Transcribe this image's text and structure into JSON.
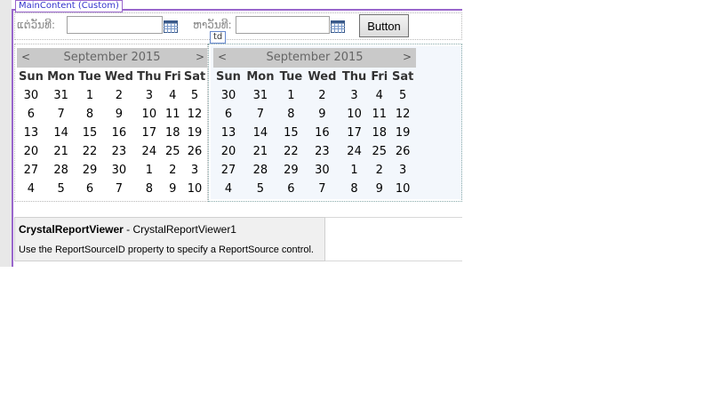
{
  "container": {
    "tag": "MainContent (Custom)"
  },
  "form": {
    "from_label": "ແຕ່ວັນທີ:",
    "from_value": "",
    "to_label": "ຫາວັນທີ:",
    "to_value": "",
    "button_label": "Button",
    "cell_tag": "td"
  },
  "calendars": [
    {
      "title": "September 2015",
      "prev": "<",
      "next": ">",
      "days": [
        "Sun",
        "Mon",
        "Tue",
        "Wed",
        "Thu",
        "Fri",
        "Sat"
      ],
      "weeks": [
        [
          "30",
          "31",
          "1",
          "2",
          "3",
          "4",
          "5"
        ],
        [
          "6",
          "7",
          "8",
          "9",
          "10",
          "11",
          "12"
        ],
        [
          "13",
          "14",
          "15",
          "16",
          "17",
          "18",
          "19"
        ],
        [
          "20",
          "21",
          "22",
          "23",
          "24",
          "25",
          "26"
        ],
        [
          "27",
          "28",
          "29",
          "30",
          "1",
          "2",
          "3"
        ],
        [
          "4",
          "5",
          "6",
          "7",
          "8",
          "9",
          "10"
        ]
      ]
    },
    {
      "title": "September 2015",
      "prev": "<",
      "next": ">",
      "days": [
        "Sun",
        "Mon",
        "Tue",
        "Wed",
        "Thu",
        "Fri",
        "Sat"
      ],
      "weeks": [
        [
          "30",
          "31",
          "1",
          "2",
          "3",
          "4",
          "5"
        ],
        [
          "6",
          "7",
          "8",
          "9",
          "10",
          "11",
          "12"
        ],
        [
          "13",
          "14",
          "15",
          "16",
          "17",
          "18",
          "19"
        ],
        [
          "20",
          "21",
          "22",
          "23",
          "24",
          "25",
          "26"
        ],
        [
          "27",
          "28",
          "29",
          "30",
          "1",
          "2",
          "3"
        ],
        [
          "4",
          "5",
          "6",
          "7",
          "8",
          "9",
          "10"
        ]
      ]
    }
  ],
  "crystal": {
    "name": "CrystalReportViewer",
    "id": " - CrystalReportViewer1",
    "message": "Use the ReportSourceID property to specify a ReportSource control."
  },
  "colors": {
    "designer_border": "#9966cc",
    "calendar_header": "#c9c9c9",
    "selected_bg": "#f3f7fc"
  },
  "icons": [
    "calendar-icon",
    "calendar-icon"
  ]
}
